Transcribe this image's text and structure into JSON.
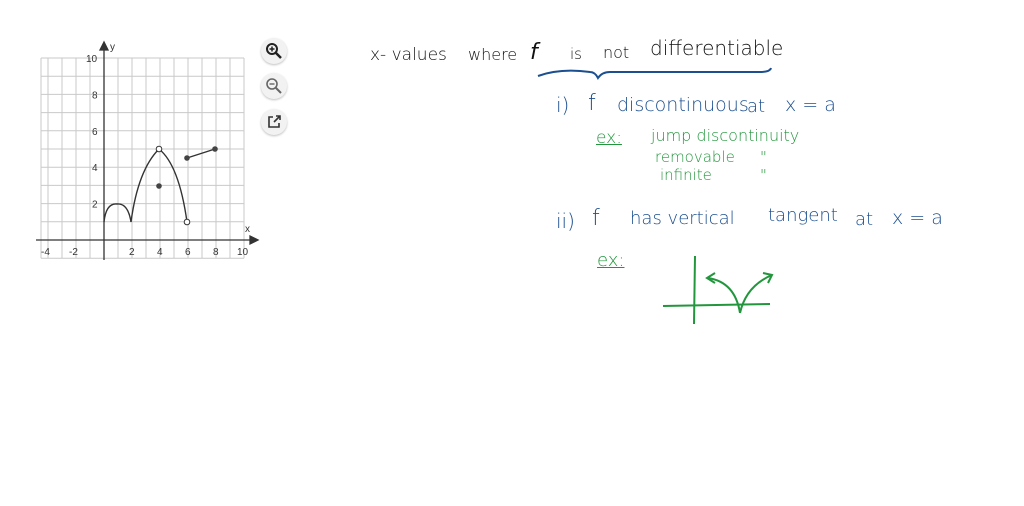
{
  "graph": {
    "x_label": "x",
    "y_label": "y",
    "x_ticks": [
      "-4",
      "-2",
      "2",
      "4",
      "6",
      "8",
      "10"
    ],
    "y_ticks": [
      "2",
      "4",
      "6",
      "8",
      "10"
    ]
  },
  "tools": {
    "zoom_in": "zoom-in",
    "zoom_out": "zoom-out",
    "open_external": "open-external"
  },
  "notes": {
    "heading": [
      "x- values",
      "where",
      "f",
      "is",
      "not",
      "differentiable"
    ],
    "item1": {
      "num": "i)",
      "f": "f",
      "text": "discontinuous",
      "at": "at",
      "cond": "x = a"
    },
    "ex1": {
      "label": "ex:",
      "lines": [
        "jump discontinuity",
        "removable",
        "infinite"
      ],
      "ditto": "\""
    },
    "item2": {
      "num": "ii)",
      "f": "f",
      "text": "has vertical",
      "tangent": "tangent",
      "at": "at",
      "cond": "x = a"
    },
    "ex2": {
      "label": "ex:"
    }
  },
  "colors": {
    "black": "#111111",
    "blue": "#1b4f8f",
    "green": "#22963c"
  }
}
